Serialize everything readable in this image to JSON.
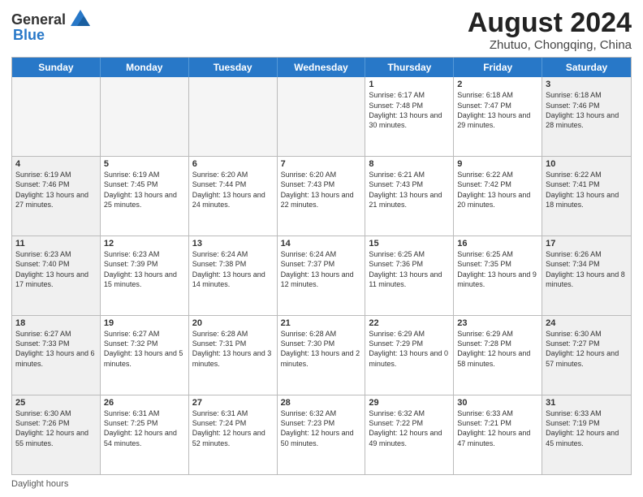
{
  "header": {
    "logo_general": "General",
    "logo_blue": "Blue",
    "month_year": "August 2024",
    "location": "Zhutuo, Chongqing, China"
  },
  "days_of_week": [
    "Sunday",
    "Monday",
    "Tuesday",
    "Wednesday",
    "Thursday",
    "Friday",
    "Saturday"
  ],
  "footer_label": "Daylight hours",
  "weeks": [
    [
      {
        "day": "",
        "text": "",
        "empty": true
      },
      {
        "day": "",
        "text": "",
        "empty": true
      },
      {
        "day": "",
        "text": "",
        "empty": true
      },
      {
        "day": "",
        "text": "",
        "empty": true
      },
      {
        "day": "1",
        "text": "Sunrise: 6:17 AM\nSunset: 7:48 PM\nDaylight: 13 hours and 30 minutes."
      },
      {
        "day": "2",
        "text": "Sunrise: 6:18 AM\nSunset: 7:47 PM\nDaylight: 13 hours and 29 minutes."
      },
      {
        "day": "3",
        "text": "Sunrise: 6:18 AM\nSunset: 7:46 PM\nDaylight: 13 hours and 28 minutes."
      }
    ],
    [
      {
        "day": "4",
        "text": "Sunrise: 6:19 AM\nSunset: 7:46 PM\nDaylight: 13 hours and 27 minutes."
      },
      {
        "day": "5",
        "text": "Sunrise: 6:19 AM\nSunset: 7:45 PM\nDaylight: 13 hours and 25 minutes."
      },
      {
        "day": "6",
        "text": "Sunrise: 6:20 AM\nSunset: 7:44 PM\nDaylight: 13 hours and 24 minutes."
      },
      {
        "day": "7",
        "text": "Sunrise: 6:20 AM\nSunset: 7:43 PM\nDaylight: 13 hours and 22 minutes."
      },
      {
        "day": "8",
        "text": "Sunrise: 6:21 AM\nSunset: 7:43 PM\nDaylight: 13 hours and 21 minutes."
      },
      {
        "day": "9",
        "text": "Sunrise: 6:22 AM\nSunset: 7:42 PM\nDaylight: 13 hours and 20 minutes."
      },
      {
        "day": "10",
        "text": "Sunrise: 6:22 AM\nSunset: 7:41 PM\nDaylight: 13 hours and 18 minutes."
      }
    ],
    [
      {
        "day": "11",
        "text": "Sunrise: 6:23 AM\nSunset: 7:40 PM\nDaylight: 13 hours and 17 minutes."
      },
      {
        "day": "12",
        "text": "Sunrise: 6:23 AM\nSunset: 7:39 PM\nDaylight: 13 hours and 15 minutes."
      },
      {
        "day": "13",
        "text": "Sunrise: 6:24 AM\nSunset: 7:38 PM\nDaylight: 13 hours and 14 minutes."
      },
      {
        "day": "14",
        "text": "Sunrise: 6:24 AM\nSunset: 7:37 PM\nDaylight: 13 hours and 12 minutes."
      },
      {
        "day": "15",
        "text": "Sunrise: 6:25 AM\nSunset: 7:36 PM\nDaylight: 13 hours and 11 minutes."
      },
      {
        "day": "16",
        "text": "Sunrise: 6:25 AM\nSunset: 7:35 PM\nDaylight: 13 hours and 9 minutes."
      },
      {
        "day": "17",
        "text": "Sunrise: 6:26 AM\nSunset: 7:34 PM\nDaylight: 13 hours and 8 minutes."
      }
    ],
    [
      {
        "day": "18",
        "text": "Sunrise: 6:27 AM\nSunset: 7:33 PM\nDaylight: 13 hours and 6 minutes."
      },
      {
        "day": "19",
        "text": "Sunrise: 6:27 AM\nSunset: 7:32 PM\nDaylight: 13 hours and 5 minutes."
      },
      {
        "day": "20",
        "text": "Sunrise: 6:28 AM\nSunset: 7:31 PM\nDaylight: 13 hours and 3 minutes."
      },
      {
        "day": "21",
        "text": "Sunrise: 6:28 AM\nSunset: 7:30 PM\nDaylight: 13 hours and 2 minutes."
      },
      {
        "day": "22",
        "text": "Sunrise: 6:29 AM\nSunset: 7:29 PM\nDaylight: 13 hours and 0 minutes."
      },
      {
        "day": "23",
        "text": "Sunrise: 6:29 AM\nSunset: 7:28 PM\nDaylight: 12 hours and 58 minutes."
      },
      {
        "day": "24",
        "text": "Sunrise: 6:30 AM\nSunset: 7:27 PM\nDaylight: 12 hours and 57 minutes."
      }
    ],
    [
      {
        "day": "25",
        "text": "Sunrise: 6:30 AM\nSunset: 7:26 PM\nDaylight: 12 hours and 55 minutes."
      },
      {
        "day": "26",
        "text": "Sunrise: 6:31 AM\nSunset: 7:25 PM\nDaylight: 12 hours and 54 minutes."
      },
      {
        "day": "27",
        "text": "Sunrise: 6:31 AM\nSunset: 7:24 PM\nDaylight: 12 hours and 52 minutes."
      },
      {
        "day": "28",
        "text": "Sunrise: 6:32 AM\nSunset: 7:23 PM\nDaylight: 12 hours and 50 minutes."
      },
      {
        "day": "29",
        "text": "Sunrise: 6:32 AM\nSunset: 7:22 PM\nDaylight: 12 hours and 49 minutes."
      },
      {
        "day": "30",
        "text": "Sunrise: 6:33 AM\nSunset: 7:21 PM\nDaylight: 12 hours and 47 minutes."
      },
      {
        "day": "31",
        "text": "Sunrise: 6:33 AM\nSunset: 7:19 PM\nDaylight: 12 hours and 45 minutes."
      }
    ]
  ]
}
